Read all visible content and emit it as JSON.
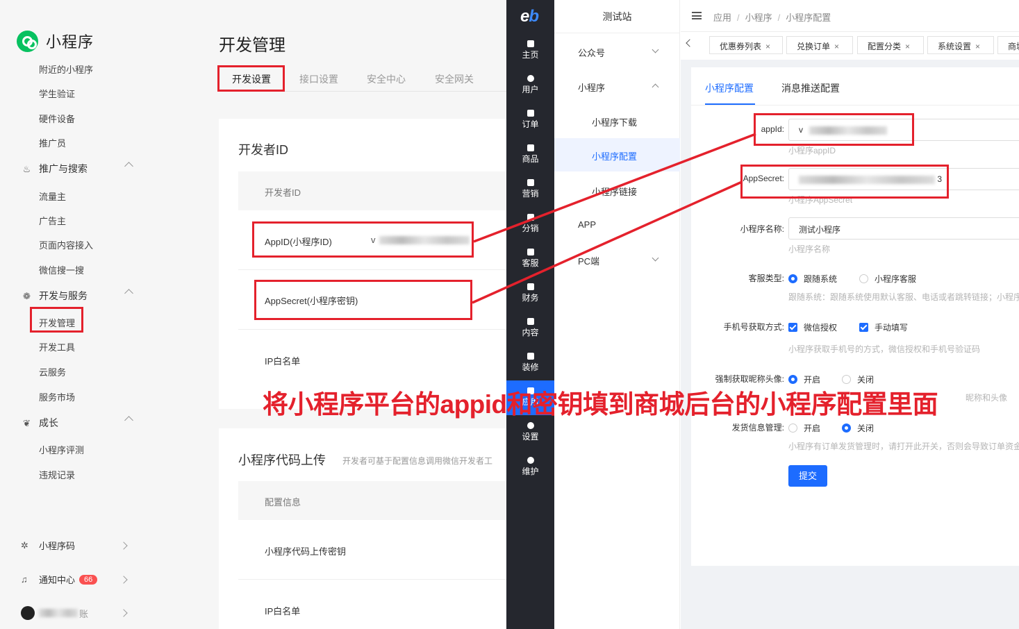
{
  "wechat": {
    "brand": "小程序",
    "sidebar": {
      "items_top": [
        "附近的小程序",
        "学生验证",
        "硬件设备",
        "推广员"
      ],
      "group_promo": {
        "label": "推广与搜索",
        "items": [
          "流量主",
          "广告主",
          "页面内容接入",
          "微信搜一搜"
        ]
      },
      "group_dev": {
        "label": "开发与服务",
        "items": [
          "开发管理",
          "开发工具",
          "云服务",
          "服务市场"
        ]
      },
      "group_grow": {
        "label": "成长",
        "items": [
          "小程序评测",
          "违规记录"
        ]
      },
      "bottom": {
        "qrcode": "小程序码",
        "notice": "通知中心",
        "notice_badge": "66",
        "account_suffix": "账"
      }
    },
    "main": {
      "title": "开发管理",
      "tabs": [
        "开发设置",
        "接口设置",
        "安全中心",
        "安全网关"
      ],
      "dev_id_card": {
        "title": "开发者ID",
        "header": "开发者ID",
        "rows": {
          "appid": "AppID(小程序ID)",
          "appid_value_prefix": "v",
          "secret": "AppSecret(小程序密钥)",
          "ip": "IP白名单"
        }
      },
      "upload_card": {
        "title": "小程序代码上传",
        "desc": "开发者可基于配置信息调用微信开发者工",
        "header": "配置信息",
        "rows": {
          "key": "小程序代码上传密钥",
          "ip": "IP白名单"
        }
      }
    }
  },
  "admin": {
    "logo": {
      "e": "e",
      "b": "b"
    },
    "nav": [
      "主页",
      "用户",
      "订单",
      "商品",
      "营销",
      "分销",
      "客服",
      "财务",
      "内容",
      "装修",
      "应用",
      "设置",
      "维护"
    ],
    "site_name": "测试站",
    "submenu": {
      "gzh": "公众号",
      "miniapp": "小程序",
      "download": "小程序下载",
      "config": "小程序配置",
      "link": "小程序链接",
      "app": "APP",
      "pc": "PC端"
    },
    "breadcrumb": [
      "应用",
      "小程序",
      "小程序配置"
    ],
    "tabs": [
      "优惠券列表",
      "兑换订单",
      "配置分类",
      "系统设置",
      "商城"
    ],
    "tab_close": "×",
    "panel": {
      "tabs": [
        "小程序配置",
        "消息推送配置"
      ],
      "fields": {
        "appid": {
          "label": "appId:",
          "value_prefix": "v",
          "help": "小程序appID"
        },
        "secret": {
          "label": "AppSecret:",
          "value_suffix": "3",
          "help": "小程序AppSecret"
        },
        "name": {
          "label": "小程序名称:",
          "value": "测试小程序",
          "help": "小程序名称"
        },
        "service": {
          "label": "客服类型:",
          "options": [
            "跟随系统",
            "小程序客服"
          ],
          "help": "跟随系统：跟随系统使用默认客服、电话或者跳转链接；小程序"
        },
        "phone": {
          "label": "手机号获取方式:",
          "options": [
            "微信授权",
            "手动填写"
          ],
          "help": "小程序获取手机号的方式，微信授权和手机号验证码"
        },
        "nick": {
          "label": "强制获取昵称头像:",
          "options": [
            "开启",
            "关闭"
          ],
          "help": "昵称和头像"
        },
        "ship": {
          "label": "发货信息管理:",
          "options": [
            "开启",
            "关闭"
          ],
          "help": "小程序有订单发货管理时，请打开此开关，否则会导致订单资金"
        }
      },
      "submit": "提交"
    }
  },
  "annotation": {
    "caption": "将小程序平台的appid和密钥填到商城后台的小程序配置里面",
    "color": "#e4212c"
  }
}
